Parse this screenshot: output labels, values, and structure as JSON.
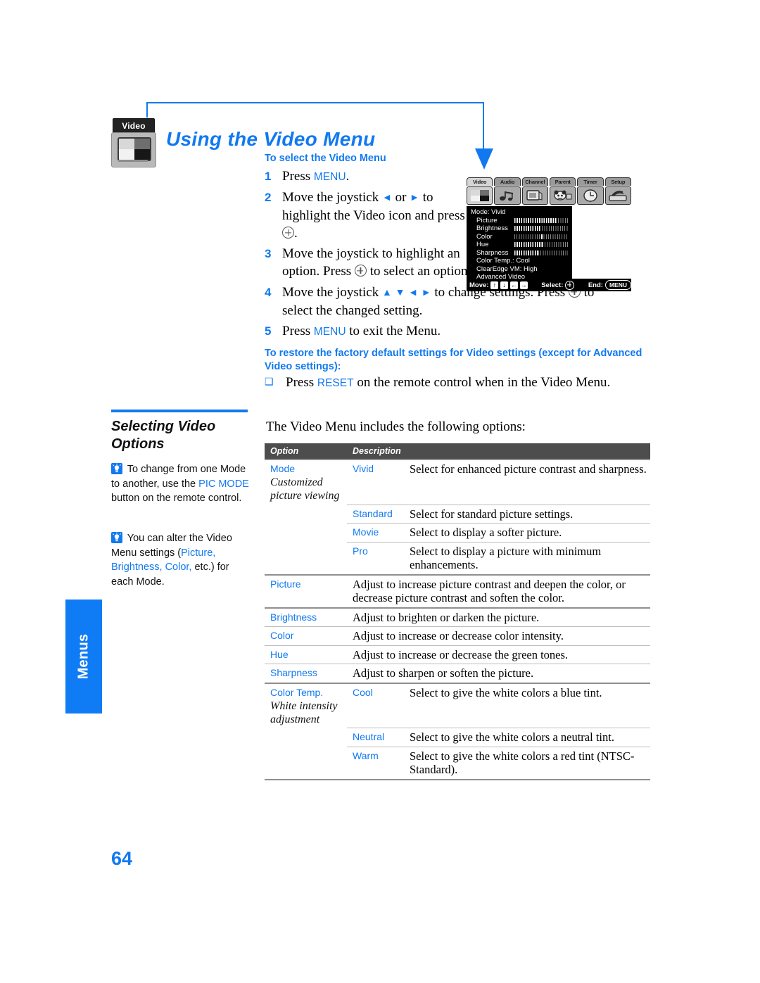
{
  "page": {
    "number": "64",
    "side_tab": "Menus"
  },
  "chapter_icon": {
    "label": "Video"
  },
  "title": "Using the Video Menu",
  "procedure": {
    "heading": "To select the Video Menu",
    "steps": [
      {
        "num": "1",
        "text_before": "Press ",
        "keyword": "MENU",
        "text_after": "."
      },
      {
        "num": "2",
        "text": "Move the joystick ← or → to highlight the Video icon and press ⊕."
      },
      {
        "num": "3",
        "text": "Move the joystick to highlight an option. Press ⊕ to select an option."
      },
      {
        "num": "4",
        "text": "Move the joystick ↑ ↓ ← → to change settings. Press ⊕ to select the changed setting."
      },
      {
        "num": "5",
        "text_before": "Press ",
        "keyword": "MENU",
        "text_after": " to exit the Menu."
      }
    ]
  },
  "restore": {
    "heading": "To restore the factory default settings for Video settings (except for Advanced Video settings):",
    "bullet": "❑",
    "text_before": "Press ",
    "keyword": "RESET",
    "text_after": " on the remote control when in the Video Menu."
  },
  "osd": {
    "tabs": [
      {
        "label": "Video",
        "selected": true
      },
      {
        "label": "Audio",
        "selected": false
      },
      {
        "label": "Channel",
        "selected": false
      },
      {
        "label": "Parent",
        "selected": false
      },
      {
        "label": "Timer",
        "selected": false
      },
      {
        "label": "Setup",
        "selected": false
      }
    ],
    "icons": [
      "video-icon",
      "audio-icon",
      "channel-icon",
      "parent-icon",
      "timer-icon",
      "setup-icon"
    ],
    "mode_line": "Mode: Vivid",
    "rows": [
      {
        "label": "Picture",
        "value_pct": 78
      },
      {
        "label": "Brightness",
        "value_pct": 48
      },
      {
        "label": "Color",
        "value_pct": 50,
        "center_marker": true
      },
      {
        "label": "Hue",
        "value_pct": 52
      },
      {
        "label": "Sharpness",
        "value_pct": 45
      }
    ],
    "sub_lines": [
      "Color Temp.: Cool",
      "ClearEdge VM: High",
      "Advanced Video"
    ],
    "footer": {
      "move_label": "Move:",
      "keys": [
        "↑",
        "↓",
        "←",
        "→"
      ],
      "select_label": "Select:",
      "end_label": "End:",
      "end_key": "MENU"
    }
  },
  "left_column": {
    "section_title": "Selecting Video Options",
    "tips": [
      {
        "icon": "tip-bulb-icon",
        "parts": [
          {
            "t": " To change from one Mode to another, use the ",
            "blue": false
          },
          {
            "t": "PIC MODE",
            "blue": true
          },
          {
            "t": " button on the remote control.",
            "blue": false
          }
        ]
      },
      {
        "icon": "tip-bulb-icon",
        "parts": [
          {
            "t": " You can alter the Video Menu settings (",
            "blue": false
          },
          {
            "t": "Picture, Brightness, Color,",
            "blue": true
          },
          {
            "t": " etc.) for each Mode.",
            "blue": false
          }
        ]
      }
    ]
  },
  "intro_line": "The Video Menu includes the following options:",
  "table": {
    "headers": [
      "Option",
      "Description"
    ],
    "rows": [
      {
        "option": "Mode",
        "option_note": "Customized picture viewing",
        "value": "Vivid",
        "description": "Select for enhanced picture contrast and sharpness.",
        "rule": "thick"
      },
      {
        "option": "",
        "option_note": "",
        "value": "Standard",
        "description": "Select for standard picture settings.",
        "rule": "thin"
      },
      {
        "option": "",
        "option_note": "",
        "value": "Movie",
        "description": "Select to display a softer picture.",
        "rule": "thin"
      },
      {
        "option": "",
        "option_note": "",
        "value": "Pro",
        "description": "Select to display a picture with minimum enhancements.",
        "rule": "thin"
      },
      {
        "option": "Picture",
        "option_note": "",
        "value": "",
        "description": "Adjust to increase picture contrast and deepen the color, or decrease picture contrast and soften the color.",
        "rule": "thick"
      },
      {
        "option": "Brightness",
        "option_note": "",
        "value": "",
        "description": "Adjust to brighten or darken the picture.",
        "rule": "thick"
      },
      {
        "option": "Color",
        "option_note": "",
        "value": "",
        "description": "Adjust to increase or decrease color intensity.",
        "rule": "thin"
      },
      {
        "option": "Hue",
        "option_note": "",
        "value": "",
        "description": "Adjust to increase or decrease the green tones.",
        "rule": "thin"
      },
      {
        "option": "Sharpness",
        "option_note": "",
        "value": "",
        "description": "Adjust to sharpen or soften the picture.",
        "rule": "thin"
      },
      {
        "option": "Color Temp.",
        "option_note": "White intensity adjustment",
        "value": "Cool",
        "description": "Select to give the white colors a blue tint.",
        "rule": "thick"
      },
      {
        "option": "",
        "option_note": "",
        "value": "Neutral",
        "description": "Select to give the white colors a neutral tint.",
        "rule": "thin"
      },
      {
        "option": "",
        "option_note": "",
        "value": "Warm",
        "description": "Select to give the white colors a red tint (NTSC-Standard).",
        "rule": "thin"
      }
    ]
  },
  "colors": {
    "accent": "#1179F0",
    "table_header_bg": "#4d4d4d",
    "side_tab": "#0F7CF5"
  }
}
